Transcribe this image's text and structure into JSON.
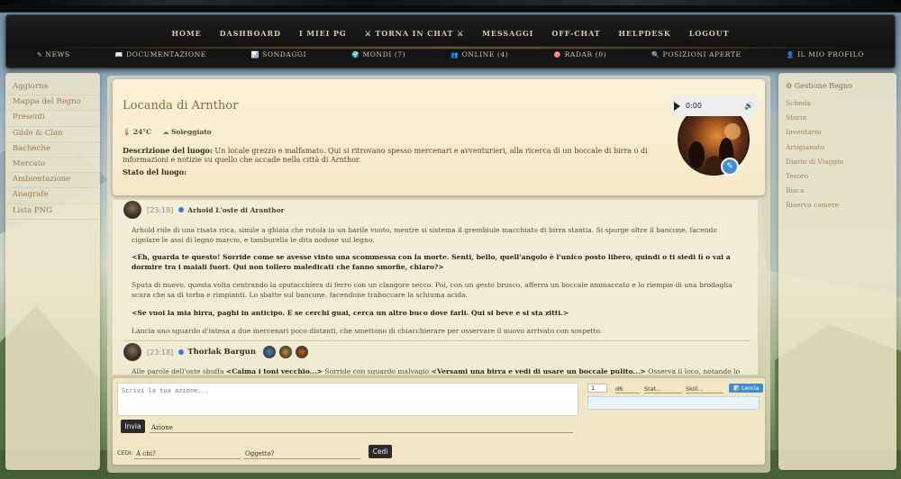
{
  "nav": {
    "items": [
      "HOME",
      "DASHBOARD",
      "I MIEI PG",
      "⚔ TORNA IN CHAT ⚔",
      "MESSAGGI",
      "OFF-CHAT",
      "HELPDESK",
      "LOGOUT"
    ]
  },
  "subnav": {
    "items": [
      {
        "icon": "✎",
        "label": "NEWS"
      },
      {
        "icon": "📖",
        "label": "DOCUMENTAZIONE"
      },
      {
        "icon": "📊",
        "label": "SONDAGGI"
      },
      {
        "icon": "🌍",
        "label": "MONDI (7)"
      },
      {
        "icon": "👥",
        "label": "ONLINE (4)"
      },
      {
        "icon": "🎯",
        "label": "RADAR (0)"
      },
      {
        "icon": "🔍",
        "label": "POSIZIONI APERTE"
      },
      {
        "icon": "👤",
        "label": "IL MIO PROFILO"
      }
    ]
  },
  "left_menu": [
    "Aggiorna",
    "Mappa del Regno",
    "Presenti",
    "Gilde & Clan",
    "Bacheche",
    "Mercato",
    "Ambientazione",
    "Anagrafe",
    "Lista PNG"
  ],
  "right_menu": {
    "title": "⚙ Gestione Regno",
    "items": [
      "Scheda",
      "Storia",
      "Inventario",
      "Artigianato",
      "Diario di Viaggio",
      "Tesoro",
      "Bisca",
      "Riserva camere"
    ]
  },
  "location": {
    "title": "Locanda di Arnthor",
    "temp_icon": "🌡",
    "temp": "24°C",
    "weather_icon": "☁",
    "weather": "Soleggiato",
    "desc_label": "Descrizione del luogo:",
    "desc": " Un locale grezzo e malfamato. Qui si ritrovano spesso mercenari e avventurieri, alla ricerca di un boccale di birra o di informazioni e notizie su quello che accade nella città di Arnthor.",
    "stato_label": "Stato del luogo:",
    "audio_time": "0:00"
  },
  "chat": {
    "msg1": {
      "time": "[23:18]",
      "name": "Arhold L'oste di Aranthor",
      "p1": "Arhold ride di una risata roca, simile a ghiaia che rotola in un barile vuoto, mentre si sistema il grembiule macchiato di birra stantia. Si sporge oltre il bancone, facendo cigolare le assi di legno marcio, e tamburella le dita nodose sul legno.",
      "s1": "<Eh, guarda te questo! Sorride come se avesse vinto una scommessa con la morte. Senti, bello, quell'angolo è l'unico posto libero, quindi o ti siedi lì o vai a dormire tra i maiali fuori. Qui non tollero maledicati che fanno smorfie, chiaro?>",
      "p2": "Sputa di nuovo, questa volta centrando la sputacchiera di ferro con un clangore secco. Poi, con un gesto brusco, afferra un boccale ammaccato e lo riempie di una brodaglia scura che sa di torba e rimpianti. Lo sbatte sul bancone, facendone traboccare la schiuma acida.",
      "s2": "<Se vuoi la mia birra, paghi in anticipo. E se cerchi guai, cerca un altro buco dove farli. Qui si beve e si sta zitti.>",
      "p3": "Lancia uno sguardo d'intesa a due mercenari poco distanti, che smettono di chiacchierare per osservare il nuovo arrivato con sospetto."
    },
    "msg2": {
      "time": "[23:18]",
      "name": "Thorlak Bargun",
      "t_a": "Alle parole dell'oste sbuffa ",
      "t_b": "<Calma i toni vecchio...>",
      "t_c": " Sorride con sguardo malvagio ",
      "t_d": "<Versami una birra e vedi di usare un boccale pulito...>",
      "t_e": " Osserva il loco, notando lo stato alquanto"
    }
  },
  "input": {
    "placeholder": "Scrivi la tua azione...",
    "invia": "Invia",
    "azione": "Azione",
    "cedi_label": "CEDI:",
    "achi": "A chi?",
    "oggetto": "Oggetto?",
    "cedi_btn": "Cedi",
    "dice_count": "1",
    "dice_type": "d6",
    "stat": "Stat...",
    "skill": "Skill...",
    "lancia": "🎲 Lancia"
  }
}
